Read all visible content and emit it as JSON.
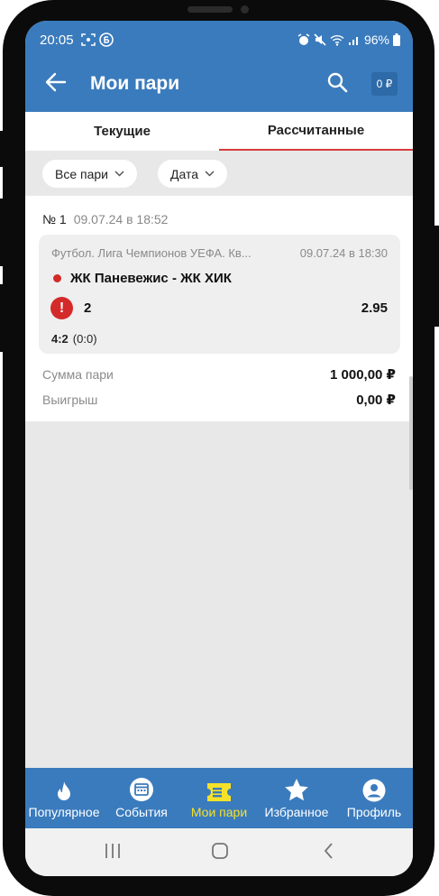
{
  "status_bar": {
    "time": "20:05",
    "battery": "96%"
  },
  "header": {
    "title": "Мои пари",
    "balance": "0 ₽"
  },
  "tabs": [
    {
      "label": "Текущие",
      "active": false
    },
    {
      "label": "Рассчитанные",
      "active": true
    }
  ],
  "filters": {
    "bets_filter": "Все пари",
    "date_filter": "Дата"
  },
  "bet": {
    "number": "№ 1",
    "placed_at": "09.07.24 в 18:52",
    "league": "Футбол. Лига Чемпионов УЕФА. Кв...",
    "event_datetime": "09.07.24 в 18:30",
    "match": "ЖК Паневежис - ЖК ХИК",
    "pick": "2",
    "odds": "2.95",
    "score": "4:2",
    "halftime_score": "(0:0)",
    "status_icon": "exclamation-alert-icon",
    "stake_label": "Сумма пари",
    "stake_value": "1 000,00 ₽",
    "win_label": "Выигрыш",
    "win_value": "0,00 ₽"
  },
  "bottom_nav": [
    {
      "label": "Популярное",
      "icon": "flame-icon",
      "active": false
    },
    {
      "label": "События",
      "icon": "calendar-icon",
      "active": false
    },
    {
      "label": "Мои пари",
      "icon": "ticket-icon",
      "active": true
    },
    {
      "label": "Избранное",
      "icon": "star-icon",
      "active": false
    },
    {
      "label": "Профиль",
      "icon": "profile-icon",
      "active": false
    }
  ],
  "colors": {
    "primary": "#3a7bbd",
    "active_nav": "#f5e12a",
    "tab_underline": "#d63c3c",
    "alert_red": "#d42a2a"
  }
}
